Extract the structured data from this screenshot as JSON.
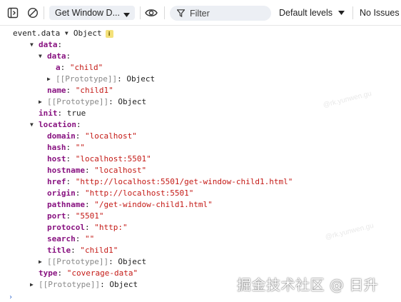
{
  "toolbar": {
    "icons": [
      "dock-panel-icon",
      "clear-console-icon",
      "eye-icon",
      "filter-icon"
    ],
    "context_select": "Get Window D...",
    "filter_placeholder": "Filter",
    "levels_label": "Default levels",
    "issues_label": "No Issues"
  },
  "tree": [
    {
      "indent": 0,
      "toggle": "expanded",
      "key": "event.data",
      "key_style": "plain",
      "value": "Object",
      "value_type": "object",
      "badge": "i"
    },
    {
      "indent": 1,
      "toggle": "expanded",
      "key": "data",
      "value": "",
      "value_type": "none"
    },
    {
      "indent": 2,
      "toggle": "expanded",
      "key": "data",
      "value": "",
      "value_type": "none"
    },
    {
      "indent": 3,
      "toggle": "none",
      "key": "a",
      "value": "\"child\"",
      "value_type": "string"
    },
    {
      "indent": 3,
      "toggle": "collapsed",
      "key": "[[Prototype]]",
      "value": "Object",
      "value_type": "proto"
    },
    {
      "indent": 2,
      "toggle": "none",
      "key": "name",
      "value": "\"child1\"",
      "value_type": "string"
    },
    {
      "indent": 2,
      "toggle": "collapsed",
      "key": "[[Prototype]]",
      "value": "Object",
      "value_type": "proto"
    },
    {
      "indent": 1,
      "toggle": "none",
      "key": "init",
      "value": "true",
      "value_type": "bool"
    },
    {
      "indent": 1,
      "toggle": "expanded",
      "key": "location",
      "value": "",
      "value_type": "none"
    },
    {
      "indent": 2,
      "toggle": "none",
      "key": "domain",
      "value": "\"localhost\"",
      "value_type": "string"
    },
    {
      "indent": 2,
      "toggle": "none",
      "key": "hash",
      "value": "\"\"",
      "value_type": "string"
    },
    {
      "indent": 2,
      "toggle": "none",
      "key": "host",
      "value": "\"localhost:5501\"",
      "value_type": "string"
    },
    {
      "indent": 2,
      "toggle": "none",
      "key": "hostname",
      "value": "\"localhost\"",
      "value_type": "string"
    },
    {
      "indent": 2,
      "toggle": "none",
      "key": "href",
      "value": "\"http://localhost:5501/get-window-child1.html\"",
      "value_type": "string"
    },
    {
      "indent": 2,
      "toggle": "none",
      "key": "origin",
      "value": "\"http://localhost:5501\"",
      "value_type": "string"
    },
    {
      "indent": 2,
      "toggle": "none",
      "key": "pathname",
      "value": "\"/get-window-child1.html\"",
      "value_type": "string"
    },
    {
      "indent": 2,
      "toggle": "none",
      "key": "port",
      "value": "\"5501\"",
      "value_type": "string"
    },
    {
      "indent": 2,
      "toggle": "none",
      "key": "protocol",
      "value": "\"http:\"",
      "value_type": "string"
    },
    {
      "indent": 2,
      "toggle": "none",
      "key": "search",
      "value": "\"\"",
      "value_type": "string"
    },
    {
      "indent": 2,
      "toggle": "none",
      "key": "title",
      "value": "\"child1\"",
      "value_type": "string"
    },
    {
      "indent": 2,
      "toggle": "collapsed",
      "key": "[[Prototype]]",
      "value": "Object",
      "value_type": "proto"
    },
    {
      "indent": 1,
      "toggle": "none",
      "key": "type",
      "value": "\"coverage-data\"",
      "value_type": "string"
    },
    {
      "indent": 1,
      "toggle": "collapsed",
      "key": "[[Prototype]]",
      "value": "Object",
      "value_type": "proto"
    }
  ],
  "prompt_symbol": "›",
  "watermark": "掘金技术社区 @ 日升",
  "faint_watermark": "@rk.yunwen.gu",
  "colors": {
    "key": "#881280",
    "string": "#c41a16",
    "proto": "#888888",
    "badge": "#f4e17a"
  }
}
